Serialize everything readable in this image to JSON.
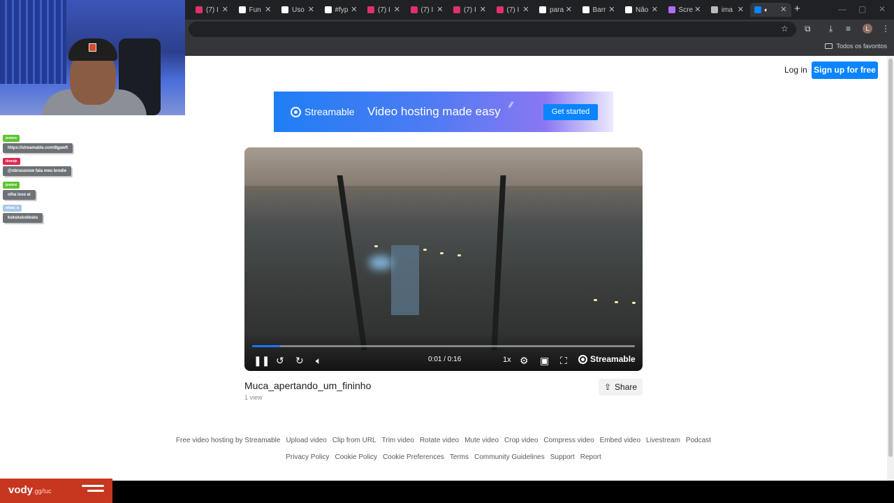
{
  "browser": {
    "tabs": [
      {
        "label": "(7) I",
        "icon": "instagram-icon",
        "color": "#e1306c"
      },
      {
        "label": "Fun",
        "icon": "tiktok-icon",
        "color": "#ffffff"
      },
      {
        "label": "Uso",
        "icon": "tiktok-icon",
        "color": "#ffffff"
      },
      {
        "label": "#fyp",
        "icon": "tiktok-icon",
        "color": "#ffffff"
      },
      {
        "label": "(7) I",
        "icon": "instagram-icon",
        "color": "#e1306c"
      },
      {
        "label": "(7) I",
        "icon": "instagram-icon",
        "color": "#e1306c"
      },
      {
        "label": "(7) I",
        "icon": "instagram-icon",
        "color": "#e1306c"
      },
      {
        "label": "(7) I",
        "icon": "instagram-icon",
        "color": "#e1306c"
      },
      {
        "label": "para",
        "icon": "tiktok-icon",
        "color": "#ffffff"
      },
      {
        "label": "Barr",
        "icon": "tiktok-icon",
        "color": "#ffffff"
      },
      {
        "label": "Não",
        "icon": "tiktok-icon",
        "color": "#ffffff"
      },
      {
        "label": "Scre",
        "icon": "feather-icon",
        "color": "#b36bff"
      },
      {
        "label": "ima",
        "icon": "globe-icon",
        "color": "#bbbbbb"
      },
      {
        "label": "",
        "icon": "streamable-icon",
        "color": "#0a84ff",
        "active": true
      }
    ],
    "bookmarks_folder": "Todos os favoritos",
    "profile_initial": "L"
  },
  "header": {
    "login": "Log in",
    "signup": "Sign up for free"
  },
  "banner": {
    "brand": "Streamable",
    "tagline": "Video hosting made easy",
    "cta": "Get started"
  },
  "player": {
    "time": "0:01 / 0:16",
    "speed": "1x",
    "brand": "Streamable",
    "progress_fraction": 0.073
  },
  "video": {
    "title": "Muca_apertando_um_fininho",
    "views": "1 view",
    "share": "Share"
  },
  "footer": {
    "row1": [
      "Free video hosting by Streamable",
      "Upload video",
      "Clip from URL",
      "Trim video",
      "Rotate video",
      "Mute video",
      "Crop video",
      "Compress video",
      "Embed video",
      "Livestream",
      "Podcast"
    ],
    "row2": [
      "Privacy Policy",
      "Cookie Policy",
      "Cookie Preferences",
      "Terms",
      "Community Guidelines",
      "Support",
      "Report"
    ]
  },
  "chat": [
    {
      "user": "josiere",
      "message": "https://streamable.com/8gawfl",
      "tag_color": "#5fc22e"
    },
    {
      "user": "tirareje",
      "message": "@obruusnow fala meu brodie",
      "tag_color": "#e2264d"
    },
    {
      "user": "josiere",
      "message": "olha isso ai",
      "tag_color": "#5fc22e"
    },
    {
      "user": "olhao_a",
      "message": "kskskskskksks",
      "tag_color": "#a9c8e8"
    }
  ],
  "overlay": {
    "brand": "vody",
    "brand_suffix": ".gg",
    "channel": "/luc"
  }
}
